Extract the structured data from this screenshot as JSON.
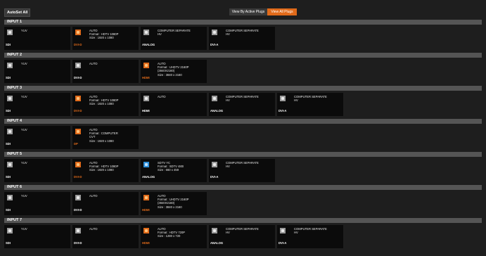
{
  "toolbar": {
    "autoset_all": "AutoSet All",
    "view_active": "View By Active Plugs",
    "view_all": "View All Plugs"
  },
  "colors": {
    "accent": "#e06a1a",
    "header": "#555555",
    "tile": "#0b0b0b",
    "hdbaset": "#2e8ed8"
  },
  "inputs": [
    {
      "title": "INPUT 1",
      "plugs": [
        {
          "type": "SDI",
          "icon": "sdi-icon",
          "icon_color": "gray",
          "type_color": "white",
          "lines": [
            "YUV"
          ]
        },
        {
          "type": "DVI-D",
          "icon": "dvi-d-icon",
          "icon_color": "orange",
          "type_color": "orange",
          "lines": [
            "AUTO",
            "Format : HDTV 1080P",
            "Size   : 1920 x 1080"
          ]
        },
        {
          "type": "ANALOG",
          "icon": "analog-icon",
          "icon_color": "gray",
          "type_color": "white",
          "lines": [
            "COMPUTER SEPARATE",
            "HV"
          ]
        },
        {
          "type": "DVI-A",
          "icon": "dvi-a-icon",
          "icon_color": "gray",
          "type_color": "white",
          "lines": [
            "COMPUTER SEPARATE",
            "HV"
          ]
        }
      ]
    },
    {
      "title": "INPUT 2",
      "plugs": [
        {
          "type": "SDI",
          "icon": "sdi-icon",
          "icon_color": "gray",
          "type_color": "white",
          "lines": [
            "YUV"
          ]
        },
        {
          "type": "DVI-D",
          "icon": "dvi-d-icon",
          "icon_color": "gray",
          "type_color": "white",
          "lines": [
            "AUTO"
          ]
        },
        {
          "type": "HDMI",
          "icon": "hdmi-icon",
          "icon_color": "orange",
          "type_color": "orange",
          "lines": [
            "AUTO",
            "Format : UHDTV 2160P",
            "(3840X2160)",
            "Size   : 3840 x 2160"
          ]
        }
      ]
    },
    {
      "title": "INPUT 3",
      "plugs": [
        {
          "type": "SDI",
          "icon": "sdi-icon",
          "icon_color": "gray",
          "type_color": "white",
          "lines": [
            "YUV"
          ]
        },
        {
          "type": "DVI-D",
          "icon": "dvi-d-icon",
          "icon_color": "orange",
          "type_color": "orange",
          "lines": [
            "AUTO",
            "Format : HDTV 1080P",
            "Size   : 1920 x 1080"
          ]
        },
        {
          "type": "HDMI",
          "icon": "hdmi-icon",
          "icon_color": "gray",
          "type_color": "white",
          "lines": [
            "AUTO"
          ]
        },
        {
          "type": "ANALOG",
          "icon": "analog-icon",
          "icon_color": "gray",
          "type_color": "white",
          "lines": [
            "COMPUTER SEPARATE",
            "HV"
          ]
        },
        {
          "type": "DVI-A",
          "icon": "dvi-a-icon",
          "icon_color": "gray",
          "type_color": "white",
          "lines": [
            "COMPUTER SEPARATE",
            "HV"
          ]
        }
      ]
    },
    {
      "title": "INPUT 4",
      "plugs": [
        {
          "type": "SDI",
          "icon": "sdi-icon",
          "icon_color": "gray",
          "type_color": "white",
          "lines": [
            "YUV"
          ]
        },
        {
          "type": "DP",
          "icon": "dp-icon",
          "icon_color": "orange",
          "type_color": "orange",
          "lines": [
            "AUTO",
            "Format : COMPUTER",
            "CVT",
            "Size   : 1920 x 1080"
          ]
        }
      ]
    },
    {
      "title": "INPUT 5",
      "plugs": [
        {
          "type": "SDI",
          "icon": "sdi-icon",
          "icon_color": "gray",
          "type_color": "white",
          "lines": [
            "YUV"
          ]
        },
        {
          "type": "DVI-D",
          "icon": "dvi-d-icon",
          "icon_color": "orange",
          "type_color": "orange",
          "lines": [
            "AUTO",
            "Format : HDTV 1080P",
            "Size   : 1920 x 1080"
          ]
        },
        {
          "type": "ANALOG",
          "icon": "analog-icon",
          "icon_color": "blue",
          "type_color": "white",
          "lines": [
            "SDTV YC",
            "Format : SDTV 480I",
            "Size   : 660 x 459"
          ]
        },
        {
          "type": "DVI-A",
          "icon": "dvi-a-icon",
          "icon_color": "gray",
          "type_color": "white",
          "lines": [
            "COMPUTER SEPARATE",
            "HV"
          ]
        }
      ]
    },
    {
      "title": "INPUT 6",
      "plugs": [
        {
          "type": "SDI",
          "icon": "sdi-icon",
          "icon_color": "gray",
          "type_color": "white",
          "lines": [
            "YUV"
          ]
        },
        {
          "type": "DVI-D",
          "icon": "dvi-d-icon",
          "icon_color": "gray",
          "type_color": "white",
          "lines": [
            "AUTO"
          ]
        },
        {
          "type": "HDMI",
          "icon": "hdmi-icon",
          "icon_color": "orange",
          "type_color": "orange",
          "lines": [
            "AUTO",
            "Format : UHDTV 2160P",
            "(3840X2160)",
            "Size   : 3840 x 2160"
          ]
        }
      ]
    },
    {
      "title": "INPUT 7",
      "plugs": [
        {
          "type": "SDI",
          "icon": "sdi-icon",
          "icon_color": "gray",
          "type_color": "white",
          "lines": [
            "YUV"
          ]
        },
        {
          "type": "DVI-D",
          "icon": "dvi-d-icon",
          "icon_color": "gray",
          "type_color": "white",
          "lines": [
            "AUTO"
          ]
        },
        {
          "type": "HDMI",
          "icon": "hdmi-icon",
          "icon_color": "orange",
          "type_color": "orange",
          "lines": [
            "AUTO",
            "Format : HDTV 720P",
            "Size   : 1280 x 720"
          ]
        },
        {
          "type": "ANALOG",
          "icon": "analog-icon",
          "icon_color": "gray",
          "type_color": "white",
          "lines": [
            "COMPUTER SEPARATE",
            "HV"
          ]
        },
        {
          "type": "DVI-A",
          "icon": "dvi-a-icon",
          "icon_color": "gray",
          "type_color": "white",
          "lines": [
            "COMPUTER SEPARATE",
            "HV"
          ]
        }
      ]
    }
  ]
}
